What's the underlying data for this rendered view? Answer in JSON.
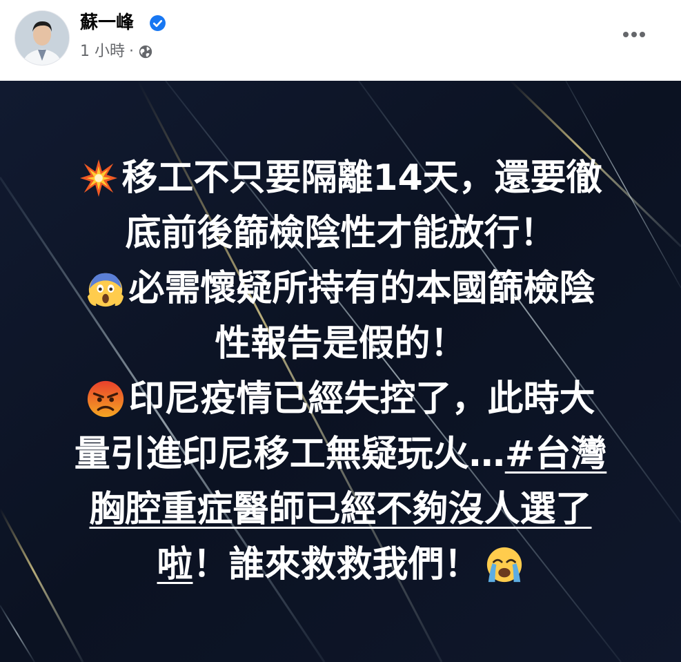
{
  "post": {
    "author_name": "蘇一峰",
    "time": "1 小時",
    "separator": "·",
    "verified_icon": "verified-badge-icon",
    "privacy_icon": "globe-icon",
    "more_icon": "more-options-icon"
  },
  "image_text": {
    "line1": "移工不只要隔離14天，還要徹",
    "line2": "底前後篩檢陰性才能放行！",
    "line3": "必需懷疑所持有的本國篩檢陰",
    "line4": "性報告是假的！",
    "line5": "印尼疫情已經失控了，此時大",
    "line6_text": "量引進印尼移工無疑玩火…",
    "line6_hashtag": "#台灣",
    "line7_hashtag": "胸腔重症醫師已經不夠沒人選了",
    "line8_hashtag": "啦",
    "line8_text": "！誰來救救我們！"
  },
  "emojis": {
    "line1": "collision-emoji",
    "line3": "screaming-face-emoji",
    "line5": "angry-face-emoji",
    "line8": "crying-face-emoji"
  },
  "colors": {
    "background": "#0d1426",
    "text": "#ffffff",
    "verified": "#1877f2",
    "secondary_text": "#65676b"
  }
}
